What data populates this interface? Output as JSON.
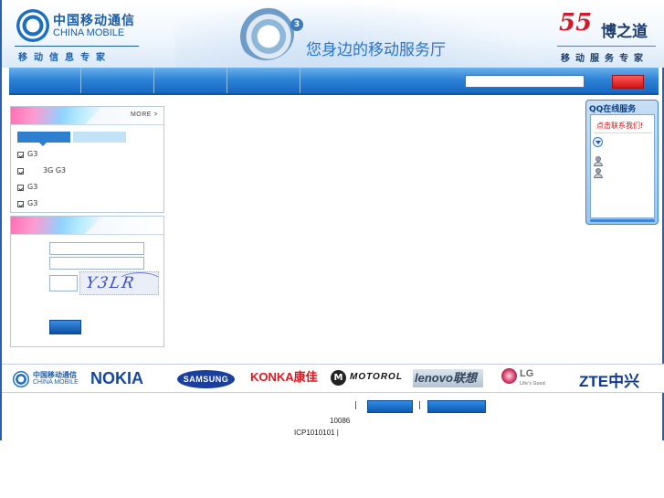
{
  "header": {
    "brand_cn": "中国移动通信",
    "brand_en": "CHINA MOBILE",
    "brand_slogan": "移动信息专家",
    "g3_badge": "3",
    "g3_slogan": "您身边的移动服务厅",
    "partner_mark": "55",
    "partner_name": "博之道",
    "partner_slogan": "移动服务专家"
  },
  "news": {
    "more_label": "MORE >",
    "items": [
      {
        "label": "G3"
      },
      {
        "label": "3G  G3"
      },
      {
        "label": "G3"
      },
      {
        "label": "G3"
      }
    ]
  },
  "login": {
    "captcha_text": "Y3LR"
  },
  "qq": {
    "title": "QQ在线服务",
    "contact_label": "点击联系我们!"
  },
  "brands": {
    "china_mobile_cn": "中国移动通信",
    "china_mobile_en": "CHINA MOBILE",
    "nokia": "NOKIA",
    "samsung": "SAMSUNG",
    "konka": "KONKA康佳",
    "motorola_icon": "M",
    "motorola": "MOTOROL",
    "lenovo": "lenovo联想",
    "lg": "LG",
    "lg_tagline": "Life's Good",
    "zte": "ZTE中兴"
  },
  "footer": {
    "sep1": "|",
    "sep2": "|",
    "hotline": "10086",
    "icp": "ICP1010101  |"
  },
  "colors": {
    "brand_blue": "#1a5ea8",
    "nav_blue": "#2f84d6",
    "search_red": "#d01414",
    "frame_blue": "#2a5fb4"
  }
}
